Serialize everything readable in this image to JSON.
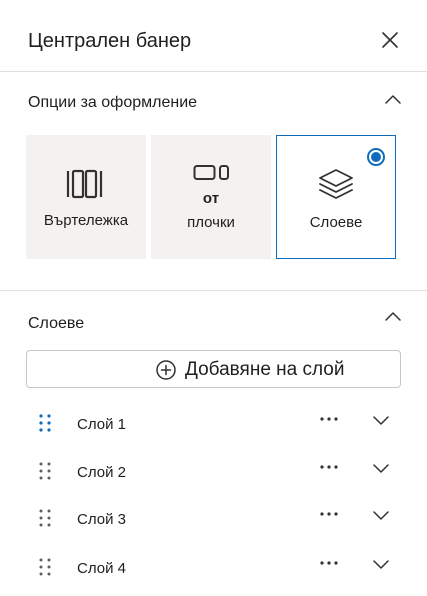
{
  "panel": {
    "title": "Централен банер",
    "close_icon": "close-icon"
  },
  "layout_options": {
    "title": "Опции за оформление",
    "cards": [
      {
        "label": "Въртележка",
        "icon": "carousel-icon",
        "selected": false
      },
      {
        "label_line1": "от",
        "label_line2": "плочки",
        "icon": "tiles-icon",
        "selected": false
      },
      {
        "label": "Слоеве",
        "icon": "layers-icon",
        "selected": true
      }
    ]
  },
  "layers": {
    "title": "Слоеве",
    "add_button_label": "Добавяне на слой",
    "items": [
      {
        "label": "Слой 1",
        "active": true
      },
      {
        "label": "Слой 2",
        "active": false
      },
      {
        "label": "Слой 3",
        "active": false
      },
      {
        "label": "Слой 4",
        "active": false
      }
    ]
  },
  "colors": {
    "accent": "#0f6cbd",
    "card_bg": "#f3f2f1",
    "divider": "#e1dfdd",
    "text": "#201f1e"
  }
}
